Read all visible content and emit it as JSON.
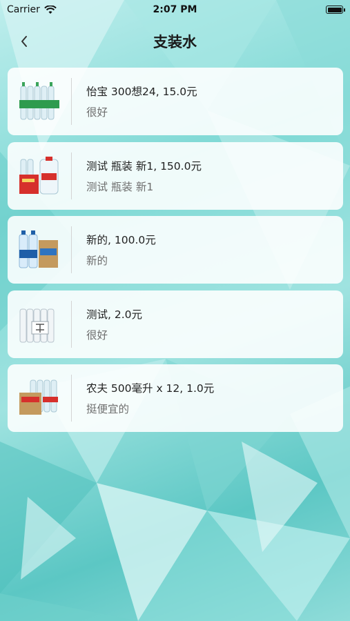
{
  "status_bar": {
    "carrier": "Carrier",
    "time": "2:07 PM",
    "battery_level": 1.0
  },
  "nav": {
    "title": "支装水",
    "back_icon": "chevron-left-icon"
  },
  "items": [
    {
      "title": "怡宝 300想24, 15.0元",
      "subtitle": "很好",
      "image": "water-pack-green-label"
    },
    {
      "title": "测试 瓶装 新1, 150.0元",
      "subtitle": "测试 瓶装 新1",
      "image": "water-box-and-jug-red"
    },
    {
      "title": "新的, 100.0元",
      "subtitle": "新的",
      "image": "water-bottles-blue-label"
    },
    {
      "title": "测试, 2.0元",
      "subtitle": "很好",
      "image": "water-bottles-clear"
    },
    {
      "title": "农夫 500毫升 x 12, 1.0元",
      "subtitle": "挺便宜的",
      "image": "water-box-red-bottles"
    }
  ],
  "colors": {
    "bg_accent": "#6fd3cf",
    "card": "#ffffff",
    "title_text": "#222222",
    "subtitle_text": "#6e6e6e"
  }
}
